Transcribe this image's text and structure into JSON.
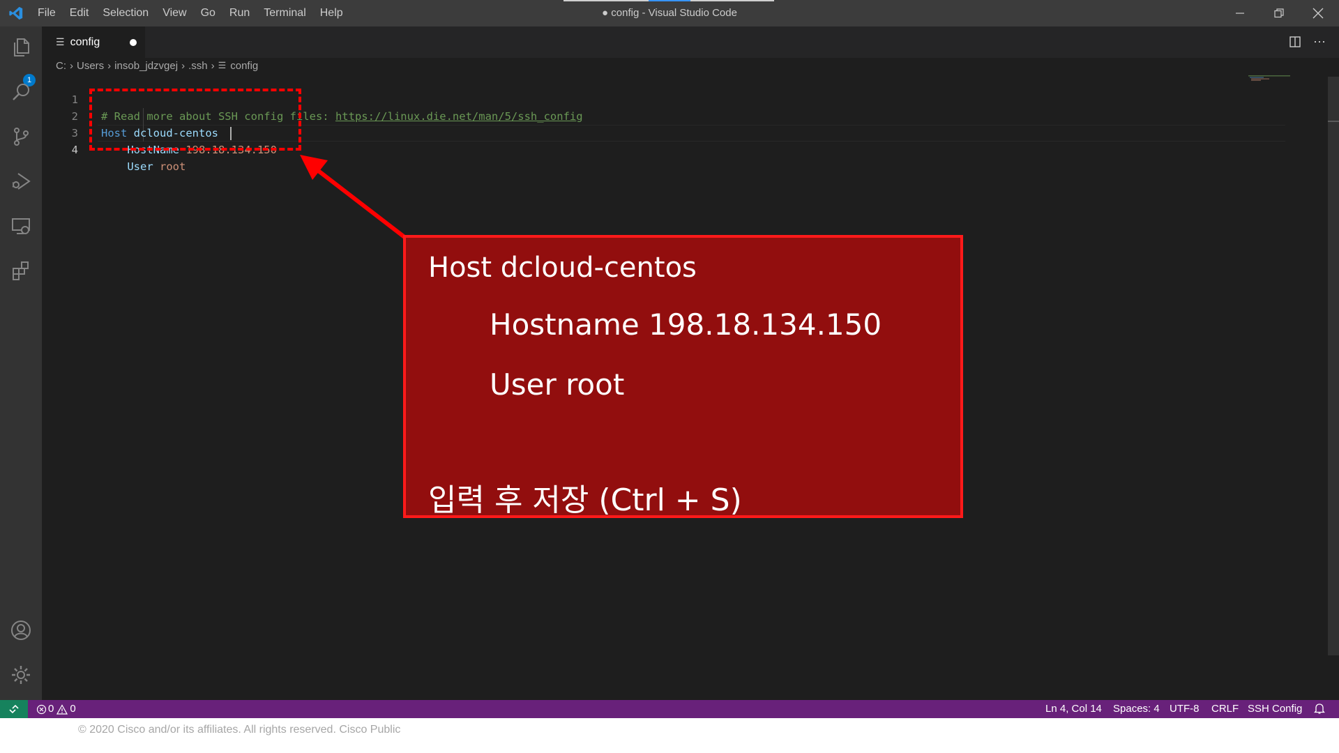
{
  "window": {
    "title": "● config - Visual Studio Code",
    "menu": [
      "File",
      "Edit",
      "Selection",
      "View",
      "Go",
      "Run",
      "Terminal",
      "Help"
    ]
  },
  "activity_bar": {
    "icons": [
      "explorer-icon",
      "search-icon",
      "source-control-icon",
      "run-debug-icon",
      "remote-explorer-icon",
      "extensions-icon",
      "account-icon",
      "manage-gear-icon"
    ],
    "explorer_badge": "1"
  },
  "tabs": [
    {
      "label": "config",
      "dirty": true,
      "icon": "file-lines-icon"
    }
  ],
  "breadcrumb": [
    "C:",
    "Users",
    "insob_jdzvgej",
    ".ssh",
    "config"
  ],
  "editor": {
    "lines": [
      {
        "number": "1",
        "comment": "# Read more about SSH config files: ",
        "link": "https://linux.die.net/man/5/ssh_config"
      },
      {
        "number": "2",
        "keyword": "Host",
        "value": "dcloud-centos"
      },
      {
        "number": "3",
        "indent": "    ",
        "keyword": "HostName",
        "value": "198.18.134.150"
      },
      {
        "number": "4",
        "indent": "    ",
        "keyword": "User",
        "value": "root"
      }
    ],
    "active_line": 4
  },
  "annotation": {
    "line1": "Host dcloud-centos",
    "line2": "Hostname 198.18.134.150",
    "line3": "User root",
    "line4_korean": "입력 후 저장",
    "line4_shortcut": " (Ctrl + S)",
    "highlight_color": "#ff0000",
    "box_color": "#920e0e"
  },
  "status_bar": {
    "errors": "0",
    "warnings": "0",
    "cursor_position": "Ln 4, Col 14",
    "indentation": "Spaces: 4",
    "encoding": "UTF-8",
    "line_ending": "CRLF",
    "language": "SSH Config",
    "background_color": "#68217a"
  },
  "footer": "© 2020 Cisco and/or its affiliates. All rights reserved. Cisco Public"
}
